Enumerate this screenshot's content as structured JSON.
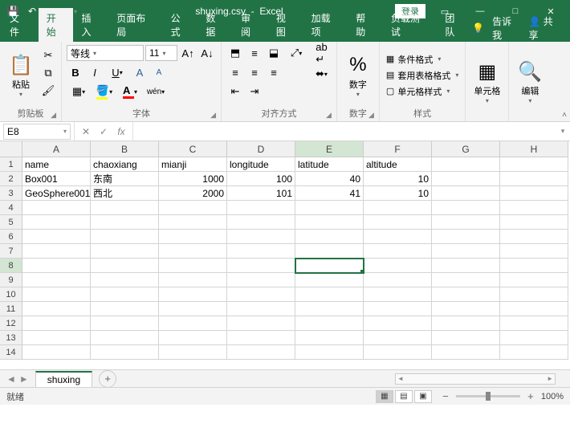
{
  "title": {
    "filename": "shuxing.csv",
    "app": "Excel",
    "login": "登录"
  },
  "tabs": {
    "file": "文件",
    "home": "开始",
    "insert": "插入",
    "layout": "页面布局",
    "formulas": "公式",
    "data": "数据",
    "review": "审阅",
    "view": "视图",
    "addins": "加载项",
    "help": "帮助",
    "loadtest": "负载测试",
    "team": "团队",
    "tellme": "告诉我",
    "share": "共享"
  },
  "ribbon": {
    "clipboard": {
      "paste": "粘贴",
      "group": "剪贴板"
    },
    "font": {
      "name": "等线",
      "size": "11",
      "group": "字体"
    },
    "align": {
      "group": "对齐方式"
    },
    "number": {
      "btn": "数字",
      "group": "数字"
    },
    "styles": {
      "cond": "条件格式",
      "table": "套用表格格式",
      "cell": "单元格样式",
      "group": "样式"
    },
    "cells": {
      "btn": "单元格"
    },
    "editing": {
      "btn": "编辑"
    }
  },
  "formulaBar": {
    "nameBox": "E8",
    "fx": "fx"
  },
  "columns": [
    "A",
    "B",
    "C",
    "D",
    "E",
    "F",
    "G",
    "H"
  ],
  "rowCount": 14,
  "selectedCell": {
    "row": 8,
    "col": 5
  },
  "cells": {
    "1": [
      "name",
      "chaoxiang",
      "mianji",
      "longitude",
      "latitude",
      "altitude",
      "",
      ""
    ],
    "2": [
      "Box001",
      "东南",
      "1000",
      "100",
      "40",
      "10",
      "",
      ""
    ],
    "3": [
      "GeoSphere001",
      "西北",
      "2000",
      "101",
      "41",
      "10",
      "",
      ""
    ]
  },
  "numericCols": [
    3,
    4,
    5,
    6
  ],
  "sheet": {
    "name": "shuxing"
  },
  "status": {
    "ready": "就绪",
    "zoom": "100%"
  }
}
